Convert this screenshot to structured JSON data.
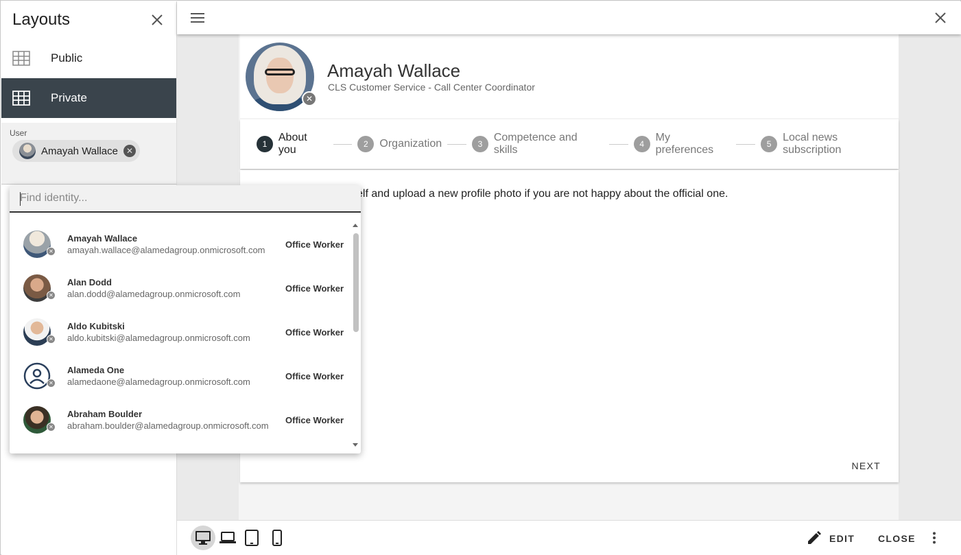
{
  "sidebar": {
    "title": "Layouts",
    "items": [
      {
        "label": "Public",
        "active": false
      },
      {
        "label": "Private",
        "active": true
      }
    ],
    "user_label": "User",
    "user_chip": "Amayah Wallace"
  },
  "dropdown": {
    "placeholder": "Find identity...",
    "rows": [
      {
        "name": "Amayah Wallace",
        "email": "amayah.wallace@alamedagroup.onmicrosoft.com",
        "type": "Office Worker"
      },
      {
        "name": "Alan Dodd",
        "email": "alan.dodd@alamedagroup.onmicrosoft.com",
        "type": "Office Worker"
      },
      {
        "name": "Aldo Kubitski",
        "email": "aldo.kubitski@alamedagroup.onmicrosoft.com",
        "type": "Office Worker"
      },
      {
        "name": "Alameda One",
        "email": "alamedaone@alamedagroup.onmicrosoft.com",
        "type": "Office Worker"
      },
      {
        "name": "Abraham Boulder",
        "email": "abraham.boulder@alamedagroup.onmicrosoft.com",
        "type": "Office Worker"
      }
    ]
  },
  "profile": {
    "name": "Amayah Wallace",
    "role": "CLS Customer Service - Call Center Coordinator"
  },
  "steps": [
    {
      "num": "1",
      "label": "About you"
    },
    {
      "num": "2",
      "label": "Organization"
    },
    {
      "num": "3",
      "label": "Competence and skills"
    },
    {
      "num": "4",
      "label": "My preferences"
    },
    {
      "num": "5",
      "label": "Local news subscription"
    }
  ],
  "body": {
    "intro": "elf and upload a new profile photo if you are not happy about the official one.",
    "next_label": "NEXT"
  },
  "bottombar": {
    "edit_label": "EDIT",
    "close_label": "CLOSE"
  }
}
